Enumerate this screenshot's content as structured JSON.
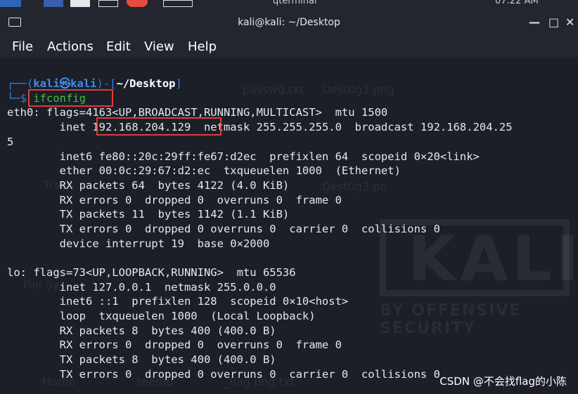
{
  "taskbar": {
    "title": "qterminal",
    "clock": "07:22 AM"
  },
  "window": {
    "title": "kali@kali: ~/Desktop",
    "minimize": "—",
    "maximize": "□",
    "close": "✕"
  },
  "menu": {
    "items": [
      "File",
      "Actions",
      "Edit",
      "View",
      "Help"
    ]
  },
  "prompt": {
    "open": "┌──(",
    "user": "kali",
    "at": "㉿",
    "host": "kali",
    "mid": ")-[",
    "dir": "~/Desktop",
    "close": "]",
    "line2": "└─$ ",
    "command": "ifconfig"
  },
  "output": {
    "l1": "eth0: flags=4163<UP,BROADCAST,RUNNING,MULTICAST>  mtu 1500",
    "l2a": "        inet ",
    "l2ip": "192.168.204.129",
    "l2b": "  netmask 255.255.255.0  broadcast 192.168.204.25",
    "l3": "5",
    "l4": "        inet6 fe80::20c:29ff:fe67:d2ec  prefixlen 64  scopeid 0×20<link>",
    "l5": "        ether 00:0c:29:67:d2:ec  txqueuelen 1000  (Ethernet)",
    "l6": "        RX packets 64  bytes 4122 (4.0 KiB)",
    "l7": "        RX errors 0  dropped 0  overruns 0  frame 0",
    "l8": "        TX packets 11  bytes 1142 (1.1 KiB)",
    "l9": "        TX errors 0  dropped 0 overruns 0  carrier 0  collisions 0",
    "l10": "        device interrupt 19  base 0×2000",
    "l11": "",
    "l12": "lo: flags=73<UP,LOOPBACK,RUNNING>  mtu 65536",
    "l13": "        inet 127.0.0.1  netmask 255.0.0.0",
    "l14": "        inet6 ::1  prefixlen 128  scopeid 0×10<host>",
    "l15": "        loop  txqueuelen 1000  (Local Loopback)",
    "l16": "        RX packets 8  bytes 400 (400.0 B)",
    "l17": "        RX errors 0  dropped 0  overruns 0  frame 0",
    "l18": "        TX packets 8  bytes 400 (400.0 B)",
    "l19": "        TX errors 0  dropped 0 overruns 0  carrier 0  collisions 0"
  },
  "desktop_watermarks": {
    "passwd": "passwd.txt",
    "dest1": "Dest0g3.png",
    "trash": "Trash",
    "dest2": "Dest0g3.pn",
    "filesystem": "File Sy",
    "home": "Home",
    "teemo": "teemo-",
    "flag": "_flag.png.txt",
    "kali": "KALI",
    "kali_sub": "BY OFFENSIVE SECURITY"
  },
  "watermark": "CSDN @不会找flag的小陈",
  "colors": {
    "terminal_bg": "#1c1f27",
    "prompt_blue": "#2f7de1",
    "command_green": "#3fc43f",
    "highlight_red": "#e23b3b"
  }
}
